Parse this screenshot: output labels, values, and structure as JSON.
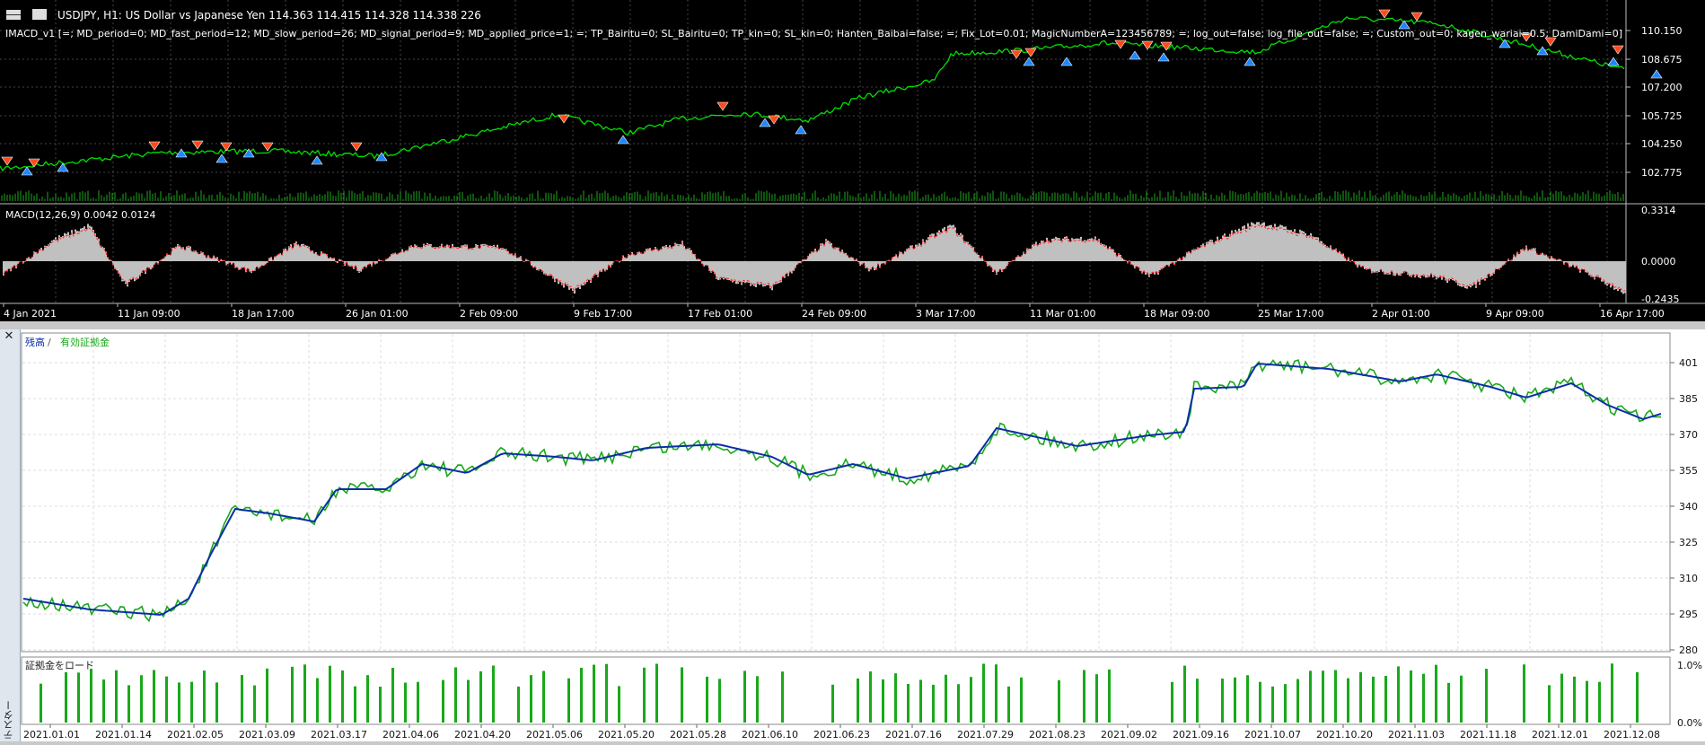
{
  "price_chart": {
    "symbol_line": "USDJPY, H1:  US Dollar vs Japanese Yen  114.363 114.415 114.328 114.338  226",
    "ea_line": "IMACD_v1 [=; MD_period=0; MD_fast_period=12; MD_slow_period=26; MD_signal_period=9; MD_applied_price=1; =; TP_Bairitu=0; SL_Bairitu=0; TP_kin=0; SL_kin=0; Hanten_Baibai=false; =; Fix_Lot=0.01; MagicNumberA=123456789; =; log_out=false; log_file_out=false; =; Custom_out=0; kagen_wariai=0.5;  DamiDami=0]",
    "price_labels": [
      "110.150",
      "108.675",
      "107.200",
      "105.725",
      "104.250",
      "102.775"
    ],
    "macd_title": "MACD(12,26,9) 0.0042 0.0124",
    "macd_labels": [
      "0.3314",
      "0.0000",
      "-0.2435"
    ],
    "time_labels": [
      "4 Jan 2021",
      "11 Jan 09:00",
      "18 Jan 17:00",
      "26 Jan 01:00",
      "2 Feb 09:00",
      "9 Feb 17:00",
      "17 Feb 01:00",
      "24 Feb 09:00",
      "3 Mar 17:00",
      "11 Mar 01:00",
      "18 Mar 09:00",
      "25 Mar 17:00",
      "2 Apr 01:00",
      "9 Apr 09:00",
      "16 Apr 17:00"
    ],
    "colors": {
      "price": "#00e000",
      "sell_arrow": "#ff4a1a",
      "buy_arrow": "#1f86ff",
      "macd_hist": "#c0c0c0",
      "macd_signal": "#ff2020",
      "grid": "#555555"
    }
  },
  "tester": {
    "legend_balance": "残高",
    "legend_sep": " / ",
    "legend_equity": "有効証拠金",
    "y_labels": [
      "401",
      "385",
      "370",
      "355",
      "340",
      "325",
      "310",
      "295",
      "280"
    ],
    "load_title": "証拠金をロード",
    "load_labels": [
      "1.0%",
      "0.0%"
    ],
    "date_labels": [
      "2021.01.01",
      "2021.01.14",
      "2021.02.05",
      "2021.03.09",
      "2021.03.17",
      "2021.04.06",
      "2021.04.20",
      "2021.05.06",
      "2021.05.20",
      "2021.05.28",
      "2021.06.10",
      "2021.06.23",
      "2021.07.16",
      "2021.07.29",
      "2021.08.23",
      "2021.09.02",
      "2021.09.16",
      "2021.10.07",
      "2021.10.20",
      "2021.11.03",
      "2021.11.18",
      "2021.12.01",
      "2021.12.08"
    ],
    "side_title": "テスター",
    "close_icon": "close-icon",
    "colors": {
      "balance": "#0a2ea8",
      "equity": "#1aa81a",
      "load_bar": "#1aa81a"
    }
  }
}
